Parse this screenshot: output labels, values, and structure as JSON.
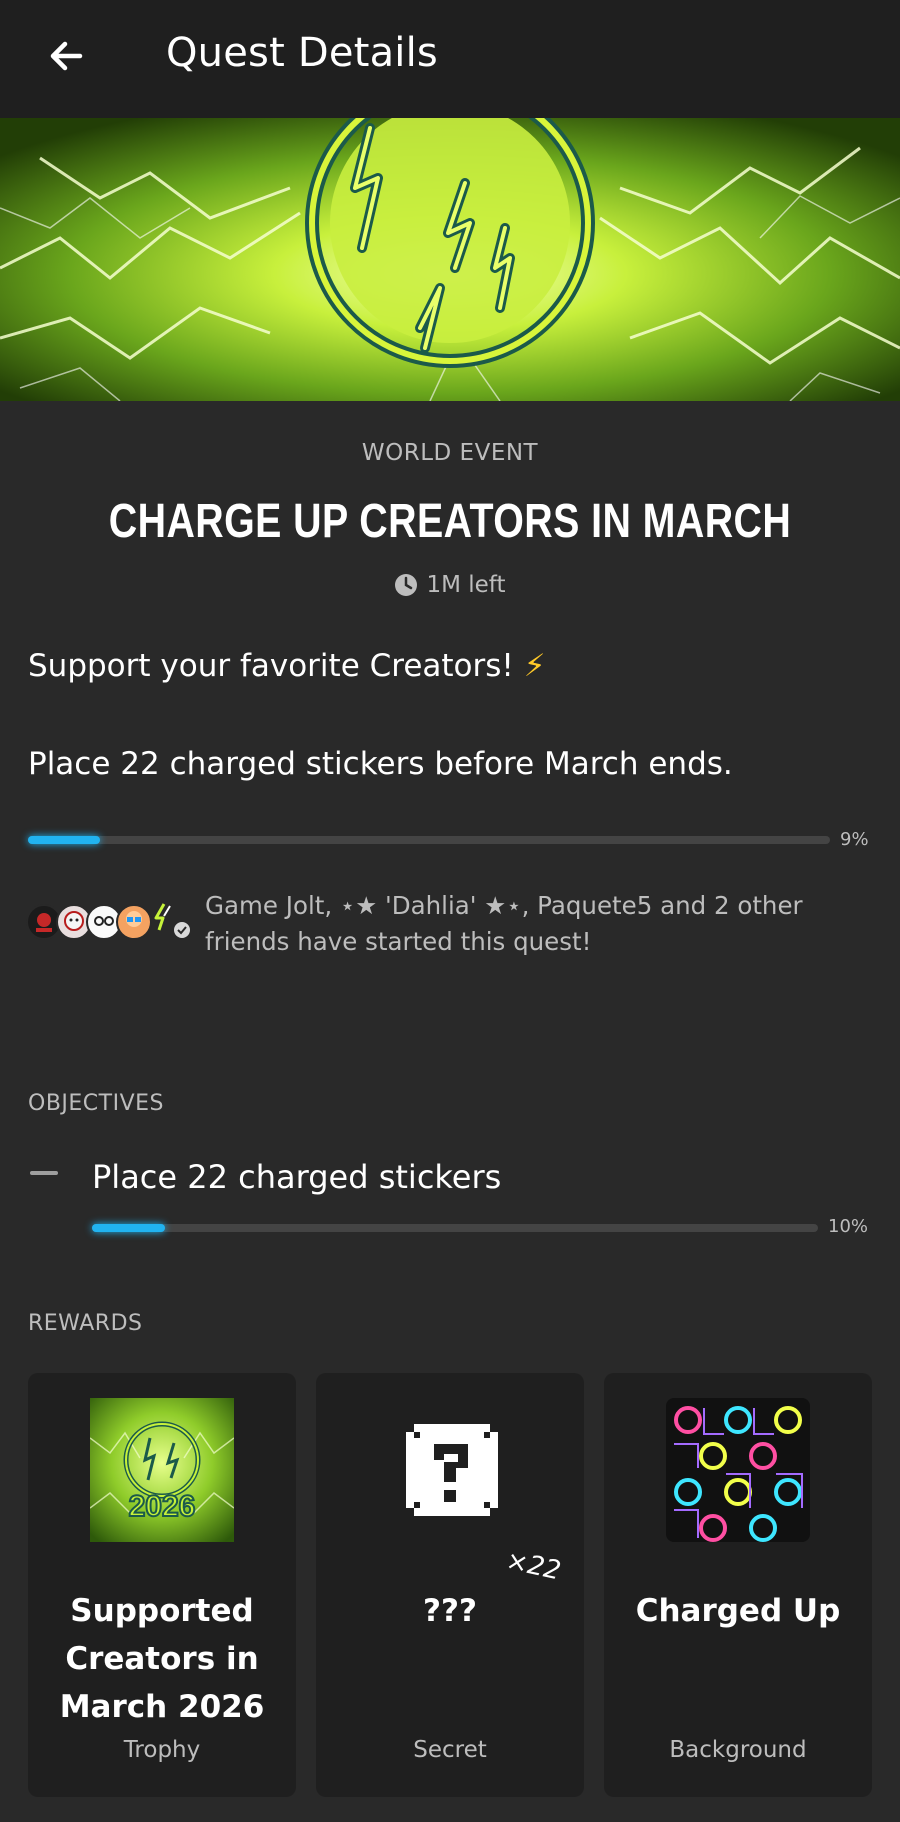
{
  "header": {
    "title": "Quest Details"
  },
  "quest": {
    "category": "WORLD EVENT",
    "title": "CHARGE UP CREATORS IN MARCH",
    "time_left": "1M left",
    "description_line1": "Support your favorite Creators!",
    "description_emoji": "⚡",
    "description_line2": "Place 22 charged stickers before March ends.",
    "progress": {
      "percent": 9,
      "label": "9%"
    },
    "friends_text": "Game Jolt, ⋆★ 'Dahlia' ★⋆, Paquete5 and 2 other friends have started this quest!"
  },
  "objectives": {
    "label": "OBJECTIVES",
    "items": [
      {
        "text": "Place 22 charged stickers",
        "percent": 10,
        "label": "10%"
      }
    ]
  },
  "rewards": {
    "label": "REWARDS",
    "items": [
      {
        "name": "Supported Creators in March 2026",
        "type": "Trophy",
        "badge_text": "2026"
      },
      {
        "name": "???",
        "type": "Secret",
        "quantity": "×22"
      },
      {
        "name": "Charged Up",
        "type": "Background"
      }
    ]
  },
  "colors": {
    "background": "#292929",
    "header": "#1f1f1f",
    "card": "#1f1f1f",
    "progress": "#21b3f0",
    "accent_green": "#c6f23a"
  }
}
